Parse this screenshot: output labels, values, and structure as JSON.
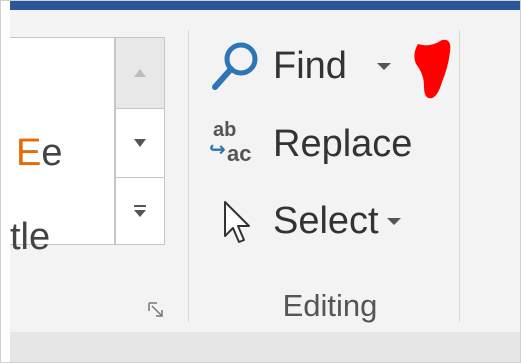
{
  "styles": {
    "sample_1_accent": "E",
    "sample_1_rest": "e",
    "sample_2_text": "tle"
  },
  "editing": {
    "find_label": "Find",
    "replace_label": "Replace",
    "select_label": "Select",
    "group_label": "Editing",
    "replace_icon_top": "ab",
    "replace_icon_bottom": "ac"
  },
  "colors": {
    "title_bar": "#2b579a",
    "ribbon_bg": "#f3f3f3",
    "accent_orange": "#e36c09",
    "icon_blue": "#2e75b6",
    "annotation_red": "#ff0000"
  },
  "icons": {
    "find": "magnifier-icon",
    "replace": "replace-ab-ac-icon",
    "select": "mouse-pointer-icon",
    "launcher": "dialog-launcher-icon"
  }
}
